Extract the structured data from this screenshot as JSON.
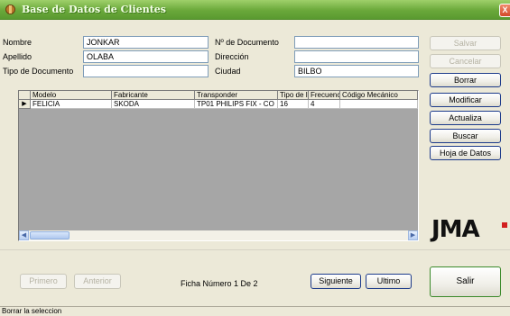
{
  "window": {
    "title": "Base de Datos de Clientes",
    "close_glyph": "X"
  },
  "form": {
    "nombre_label": "Nombre",
    "nombre_value": "JONKAR",
    "apellido_label": "Apellido",
    "apellido_value": "OLABA",
    "tipo_doc_label": "Tipo de Documento",
    "tipo_doc_value": "",
    "num_doc_label": "Nº de Documento",
    "num_doc_value": "",
    "direccion_label": "Dirección",
    "direccion_value": "",
    "ciudad_label": "Ciudad",
    "ciudad_value": "BILBO"
  },
  "actions": {
    "salvar": "Salvar",
    "cancelar": "Cancelar",
    "borrar": "Borrar",
    "modificar": "Modificar",
    "actualiza": "Actualiza",
    "buscar": "Buscar",
    "hoja": "Hoja de Datos",
    "salir": "Salir"
  },
  "grid": {
    "headers": [
      "Modelo",
      "Fabricante",
      "Transponder",
      "Tipo de I",
      "Frecuenc",
      "Código Mecánico"
    ],
    "rows": [
      [
        "FELICIA",
        "SKODA",
        "TP01 PHILIPS FIX - CO",
        "16",
        "4",
        ""
      ]
    ],
    "row_pointer": "▶"
  },
  "nav": {
    "primero": "Primero",
    "anterior": "Anterior",
    "ficha": "Ficha Número 1 De 2",
    "siguiente": "Siguiente",
    "ultimo": "Ultimo"
  },
  "logo": "JMA",
  "status": "Borrar la seleccion"
}
